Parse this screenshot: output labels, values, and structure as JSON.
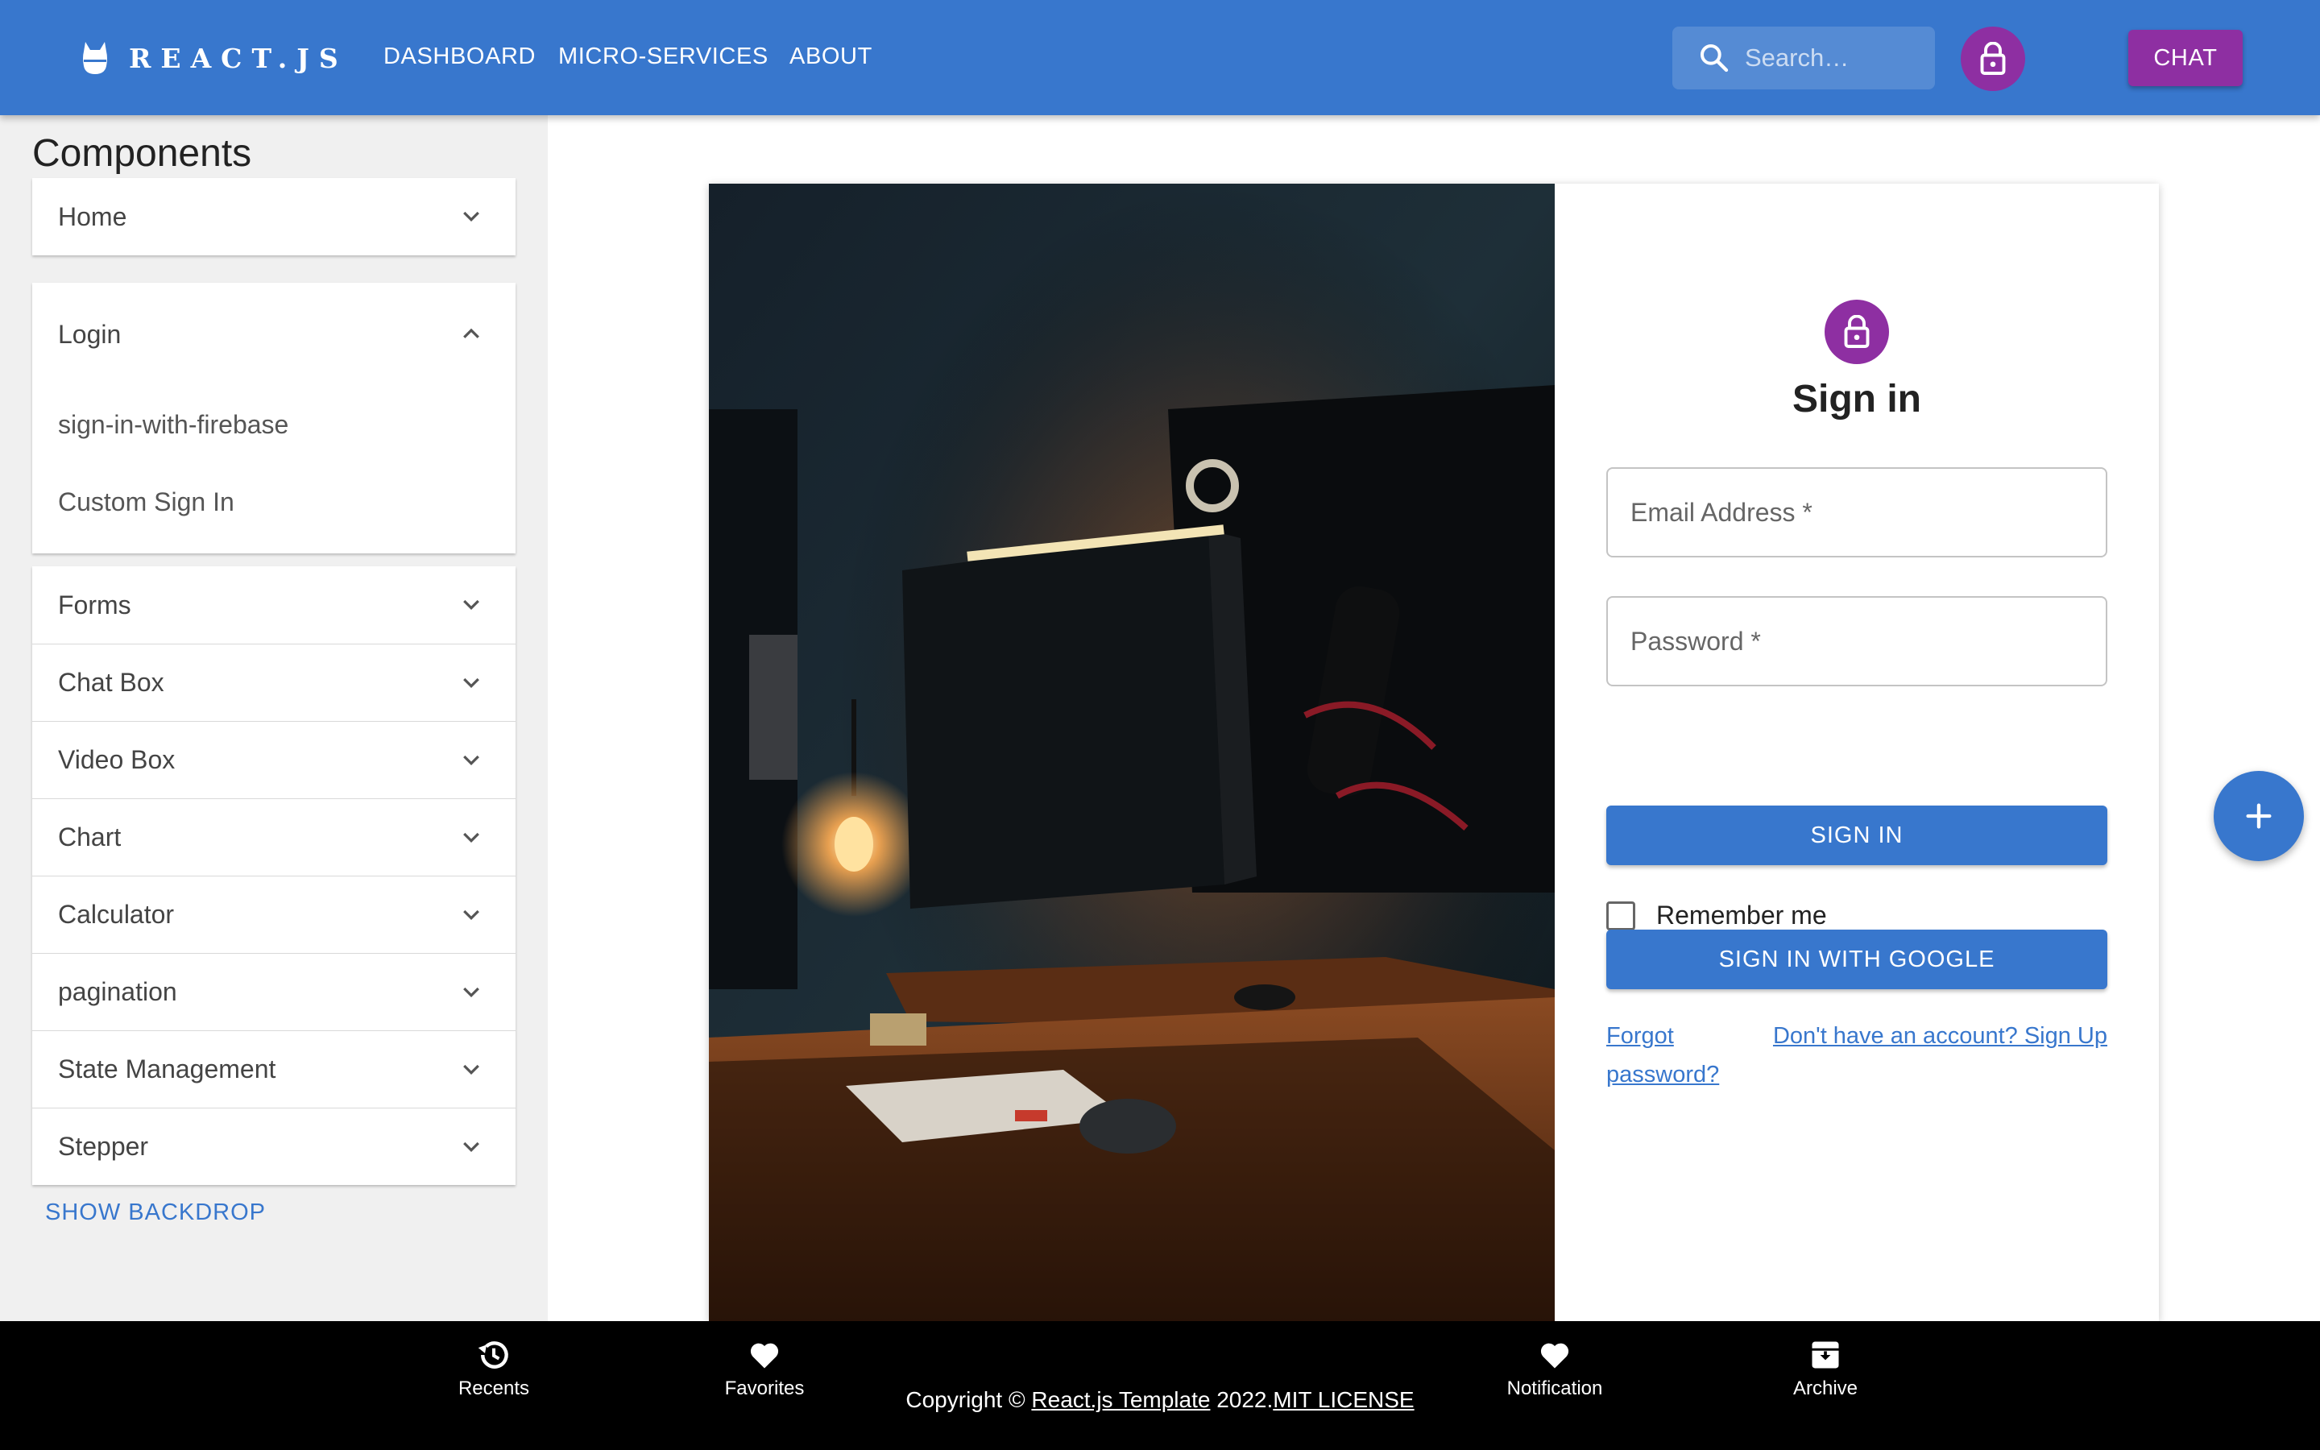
{
  "colors": {
    "primary": "#3877cd",
    "secondary": "#8e2fa2",
    "sidebar_bg": "#f0f0f0",
    "footer_bg": "#000000"
  },
  "header": {
    "brand": "REACT.JS",
    "nav": [
      "DASHBOARD",
      "MICRO-SERVICES",
      "ABOUT"
    ],
    "search_placeholder": "Search…",
    "chat_label": "CHAT",
    "icons": [
      "react-logo-icon",
      "search-icon",
      "lock-icon"
    ]
  },
  "sidebar": {
    "title": "Components",
    "home": "Home",
    "login": {
      "label": "Login",
      "expanded": true,
      "items": [
        "sign-in-with-firebase",
        "Custom Sign In"
      ]
    },
    "groups": [
      "Forms",
      "Chat Box",
      "Video Box",
      "Chart",
      "Calculator",
      "pagination",
      "State Management",
      "Stepper"
    ],
    "show_backdrop": "SHOW BACKDROP"
  },
  "signin": {
    "title": "Sign in",
    "email_placeholder": "Email Address *",
    "password_placeholder": "Password *",
    "remember_label": "Remember me",
    "remember_checked": false,
    "sign_in_button": "SIGN IN",
    "google_button": "SIGN IN WITH GOOGLE",
    "forgot_line1": "Forgot",
    "forgot_line2": "password?",
    "signup_link": "Don't have an account? Sign Up",
    "image": "desk-setup-photo"
  },
  "fab": {
    "icon": "plus-icon"
  },
  "footer": {
    "nav": [
      {
        "label": "Recents",
        "icon": "history-icon"
      },
      {
        "label": "Favorites",
        "icon": "heart-icon"
      },
      {
        "label": "Notification",
        "icon": "heart-icon"
      },
      {
        "label": "Archive",
        "icon": "archive-icon"
      }
    ],
    "copyright_prefix": "Copyright © ",
    "copyright_link": "React.js Template",
    "copyright_year": " 2022.",
    "license_link": "MIT LICENSE"
  }
}
